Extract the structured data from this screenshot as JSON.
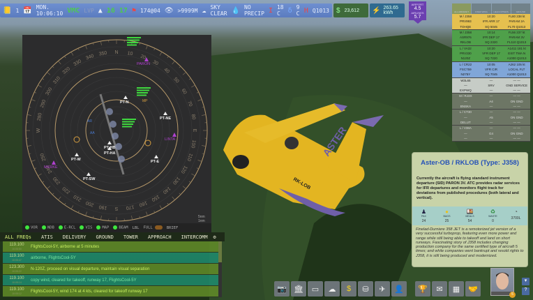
{
  "topbar": {
    "players": "1",
    "datetime": "MON. 10:06:10",
    "vfr": "VMC",
    "lvp": "LVP",
    "runway_a": "16",
    "runway_b": "17",
    "wind": "174@04",
    "visibility": ">9999M",
    "sky": "SKY CLEAR",
    "precip": "NO PRECIP",
    "temp": "18 C",
    "dewpoint": "9 C",
    "pressure": "Q1013"
  },
  "money": "23,612",
  "energy": "263.65 kWh",
  "badge": {
    "airport_label": "AIRPORT",
    "airport_value": "4.5",
    "airlines_label": "AIRLINES",
    "airlines_value": "5.7"
  },
  "strip_tabs": [
    "ALL AIRCRAFT",
    "FIXED WING",
    "HELICOPTERS",
    "GROUND SERVICES"
  ],
  "strips": [
    {
      "color": "y",
      "cells": [
        "M / J358",
        "10:20",
        "FL80  238 kt",
        "PRV993",
        "IFR  ARR 17",
        "PARAM 2A",
        "TOHQE",
        "SQ 5045",
        "FL70  Q1013"
      ]
    },
    {
      "color": "g",
      "cells": [
        "M / J358",
        "10:14",
        "FL56  237 kt",
        "ASR976",
        "IFR  DEP 17",
        "PARAM 3V",
        "RKLOB",
        "SQ 2320",
        "FL110  Q1013"
      ]
    },
    {
      "color": "g",
      "cells": [
        "L / VA32",
        "10:20",
        "A1411  181 kt",
        "PRV330",
        "VFR  DEP 17",
        "EXIT TMA N",
        "N120Z",
        "SQ 7220",
        "A1000  Q1013"
      ]
    },
    {
      "color": "b",
      "cells": [
        "L / CR22",
        "10:05",
        "A262  105 kt",
        "FSC759",
        "VFR  CIR",
        "LOCAL FLT",
        "N275Y",
        "SQ 7045",
        "A1000  Q1013"
      ]
    },
    {
      "color": "w",
      "cells": [
        "W3L65",
        "—",
        "— —",
        "—",
        "SRV",
        "GND SERVICE",
        "EXPWQ",
        "—",
        "— —"
      ]
    },
    {
      "color": "d",
      "cells": [
        "M / RJ3X",
        "—",
        "— —",
        "—",
        "A4",
        "ON GND",
        "BNSKA",
        "—",
        "— —"
      ]
    },
    {
      "color": "d",
      "cells": [
        "L / CT30",
        "—",
        "— —",
        "—",
        "A5",
        "ON GND",
        "DELUT",
        "—",
        "— —"
      ]
    },
    {
      "color": "d",
      "cells": [
        "L / V38A",
        "—",
        "— —",
        "—",
        "G4",
        "ON GND",
        "—",
        "—",
        "— —"
      ]
    }
  ],
  "radar": {
    "waypoints": [
      "PT-N",
      "PT-NE",
      "PT-E",
      "PT-W",
      "PT-SW",
      "PT-HB",
      "PT-HA"
    ],
    "fixes": [
      "PARON",
      "LINTA",
      "MERKE"
    ],
    "bearings": [
      "N",
      "10",
      "20",
      "30",
      "40",
      "50",
      "60",
      "70",
      "80",
      "E",
      "100",
      "110",
      "120",
      "130",
      "140",
      "150",
      "160",
      "170",
      "S",
      "190",
      "200",
      "210",
      "220",
      "230",
      "240",
      "250",
      "W",
      "280",
      "290",
      "300",
      "310",
      "320",
      "330",
      "340",
      "350"
    ],
    "legend": [
      "5nm",
      "1nm"
    ],
    "tags": [
      "AR",
      "AA",
      "MP"
    ]
  },
  "filters": [
    "VOR",
    "NDB",
    "E-RCL",
    "VIS",
    "MAP",
    "BEAM",
    "LBL",
    "FULL",
    "BRIEF"
  ],
  "freq_tabs": [
    "ALL FREQs",
    "ATIS",
    "DELIVERY",
    "GROUND",
    "TOWER",
    "APPROACH",
    "INTERCOMM"
  ],
  "log": [
    {
      "freq": "119.100",
      "time": "10:05:50",
      "msg": "FlightsCool-5Y, airborne at 5 minutes",
      "kind": "a"
    },
    {
      "freq": "119.100",
      "time": "10:05:47",
      "msg": "airborne, FlightsCool-5Y",
      "kind": "t"
    },
    {
      "freq": "123.300",
      "time": "10:05:22",
      "msg": "N-120Z, proceed on visual departure, maintain visual separation",
      "kind": "a"
    },
    {
      "freq": "119.100",
      "time": "10:05:14",
      "msg": "copy wind, cleared for takeoff, runway 17, FlightsCool-5Y",
      "kind": "t"
    },
    {
      "freq": "119.100",
      "time": "10:05:12",
      "msg": "FlightsCool-5Y, wind 174 at 4 kts, cleared for takeoff runway 17",
      "kind": "a"
    }
  ],
  "aircraft_reg": "RK-LOB",
  "livery": "ASTER",
  "info": {
    "title": "Aster-OB / RKLOB (Type: J358)",
    "desc": "Currently the aircraft is flying standard instrument departure (SID) PARON 3V. ATC provides radar services for IFR departures and monitors flight track for deviations from published procedures (both lateral and vertical).",
    "stats": [
      {
        "label": "PAX",
        "value": "24"
      },
      {
        "label": "BAGS",
        "value": "25"
      },
      {
        "label": "MEALS",
        "value": "54"
      },
      {
        "label": "WASTE",
        "value": "0"
      },
      {
        "label": "",
        "value": "3700L"
      }
    ],
    "lore": "Finelad-Durniere 358 JET is a remotorized jet version of a very successful turboprop, featuring even more power and range while still being able to takeoff and land on short runways. Fascinating story of J358 includes changing production company for the same certified type of aircraft 5 times; and while companies went bankrupt and resold rights to J358, it is still being produced and modernized."
  },
  "toolbar": [
    "camera-icon",
    "terminal-icon",
    "hangar-icon",
    "weather-icon",
    "finance-icon",
    "fuel-icon",
    "airline-icon",
    "staff-icon",
    "trophy-icon",
    "mail-icon",
    "schedule-icon",
    "handshake-icon"
  ],
  "player_level": "5"
}
